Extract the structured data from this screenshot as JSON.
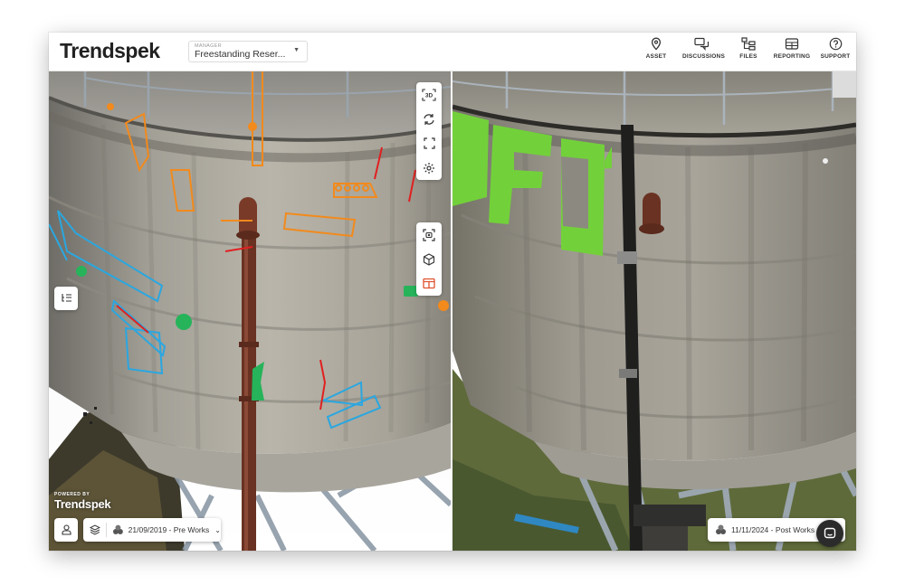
{
  "app": {
    "logo_text_main": "Trendspek",
    "asset_select": {
      "label": "MANAGER",
      "value": "Freestanding Reser..."
    }
  },
  "nav": [
    {
      "label": "ASSET",
      "icon": "map-pin-icon"
    },
    {
      "label": "DISCUSSIONS",
      "icon": "chat-bubbles-icon"
    },
    {
      "label": "FILES",
      "icon": "file-tree-icon"
    },
    {
      "label": "REPORTING",
      "icon": "table-icon"
    },
    {
      "label": "SUPPORT",
      "icon": "help-circle-icon"
    }
  ],
  "left_toolbar": [
    {
      "icon": "3d-view-icon",
      "text": "3D"
    },
    {
      "icon": "rotate-icon"
    },
    {
      "icon": "fullscreen-icon"
    },
    {
      "icon": "settings-gear-icon"
    }
  ],
  "left_toolbar_2": [
    {
      "icon": "focus-camera-icon"
    },
    {
      "icon": "cube-icon"
    },
    {
      "icon": "split-view-icon",
      "active": true
    }
  ],
  "accent_color": "#e0522f",
  "left_pane": {
    "powered_by": "POWERED BY",
    "powered_logo": "Trendspek",
    "date_selector": "21/09/2019 - Pre Works"
  },
  "right_pane": {
    "date_selector": "11/11/2024 - Post Works"
  }
}
